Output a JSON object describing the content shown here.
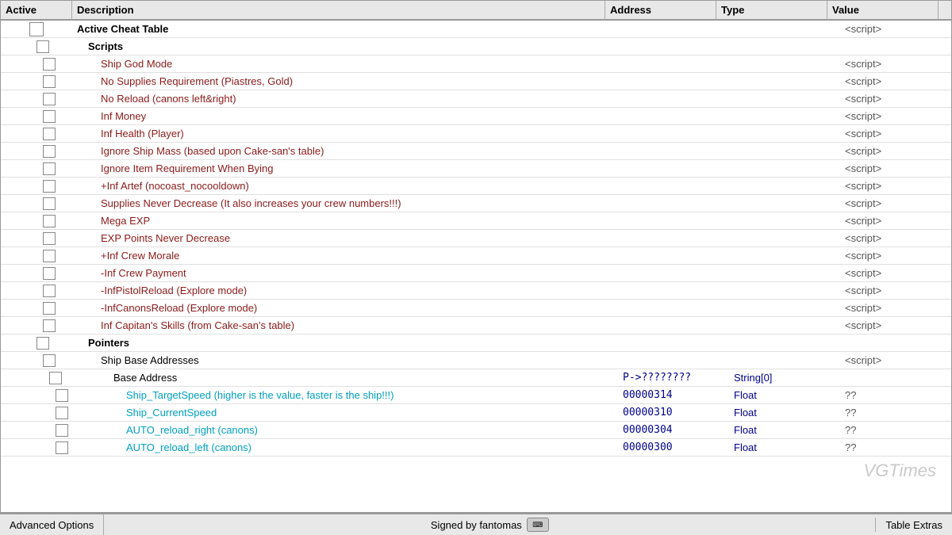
{
  "header": {
    "col_active": "Active",
    "col_desc": "Description",
    "col_addr": "Address",
    "col_type": "Type",
    "col_value": "Value"
  },
  "rows": [
    {
      "level": "root",
      "desc": "Active Cheat Table",
      "addr": "",
      "type": "",
      "value": "<script>"
    },
    {
      "level": "level1",
      "desc": "Scripts",
      "addr": "",
      "type": "",
      "value": ""
    },
    {
      "level": "level2",
      "desc": "Ship God Mode",
      "addr": "",
      "type": "",
      "value": "<script>"
    },
    {
      "level": "level2",
      "desc": "No Supplies Requirement (Piastres, Gold)",
      "addr": "",
      "type": "",
      "value": "<script>"
    },
    {
      "level": "level2",
      "desc": "No Reload (canons left&right)",
      "addr": "",
      "type": "",
      "value": "<script>"
    },
    {
      "level": "level2",
      "desc": "Inf Money",
      "addr": "",
      "type": "",
      "value": "<script>"
    },
    {
      "level": "level2",
      "desc": "Inf Health (Player)",
      "addr": "",
      "type": "",
      "value": "<script>"
    },
    {
      "level": "level2",
      "desc": "Ignore Ship Mass  (based upon Cake-san's table)",
      "addr": "",
      "type": "",
      "value": "<script>"
    },
    {
      "level": "level2",
      "desc": "Ignore Item Requirement When Bying",
      "addr": "",
      "type": "",
      "value": "<script>"
    },
    {
      "level": "level2",
      "desc": "+Inf Artef (nocoast_nocooldown)",
      "addr": "",
      "type": "",
      "value": "<script>"
    },
    {
      "level": "level2",
      "desc": "Supplies Never Decrease (It also increases your crew numbers!!!)",
      "addr": "",
      "type": "",
      "value": "<script>"
    },
    {
      "level": "level2",
      "desc": "Mega EXP",
      "addr": "",
      "type": "",
      "value": "<script>"
    },
    {
      "level": "level2",
      "desc": "EXP Points Never Decrease",
      "addr": "",
      "type": "",
      "value": "<script>"
    },
    {
      "level": "level2",
      "desc": "+Inf Crew Morale",
      "addr": "",
      "type": "",
      "value": "<script>"
    },
    {
      "level": "level2",
      "desc": "-Inf Crew Payment",
      "addr": "",
      "type": "",
      "value": "<script>"
    },
    {
      "level": "level2",
      "desc": "-InfPistolReload (Explore mode)",
      "addr": "",
      "type": "",
      "value": "<script>"
    },
    {
      "level": "level2",
      "desc": "-InfCanonsReload (Explore mode)",
      "addr": "",
      "type": "",
      "value": "<script>"
    },
    {
      "level": "level2",
      "desc": "Inf Capitan's Skills (from Cake-san's table)",
      "addr": "",
      "type": "",
      "value": "<script>"
    },
    {
      "level": "pointers",
      "desc": "Pointers",
      "addr": "",
      "type": "",
      "value": ""
    },
    {
      "level": "ship-base",
      "desc": "Ship Base Addresses",
      "addr": "",
      "type": "",
      "value": "<script>"
    },
    {
      "level": "base-addr",
      "desc": "Base Address",
      "addr": "P->????????",
      "type": "String[0]",
      "value": ""
    },
    {
      "level": "pointer-child",
      "desc": "Ship_TargetSpeed (higher is the value, faster is the ship!!!)",
      "addr": "00000314",
      "type": "Float",
      "value": "??"
    },
    {
      "level": "pointer-child",
      "desc": "Ship_CurrentSpeed",
      "addr": "00000310",
      "type": "Float",
      "value": "??"
    },
    {
      "level": "pointer-child",
      "desc": "AUTO_reload_right (canons)",
      "addr": "00000304",
      "type": "Float",
      "value": "??"
    },
    {
      "level": "pointer-child",
      "desc": "AUTO_reload_left (canons)",
      "addr": "00000300",
      "type": "Float",
      "value": "??"
    }
  ],
  "status_bar": {
    "left": "Advanced Options",
    "center": "Signed by fantomas",
    "right": "Table Extras"
  },
  "watermark": "VGTimes"
}
